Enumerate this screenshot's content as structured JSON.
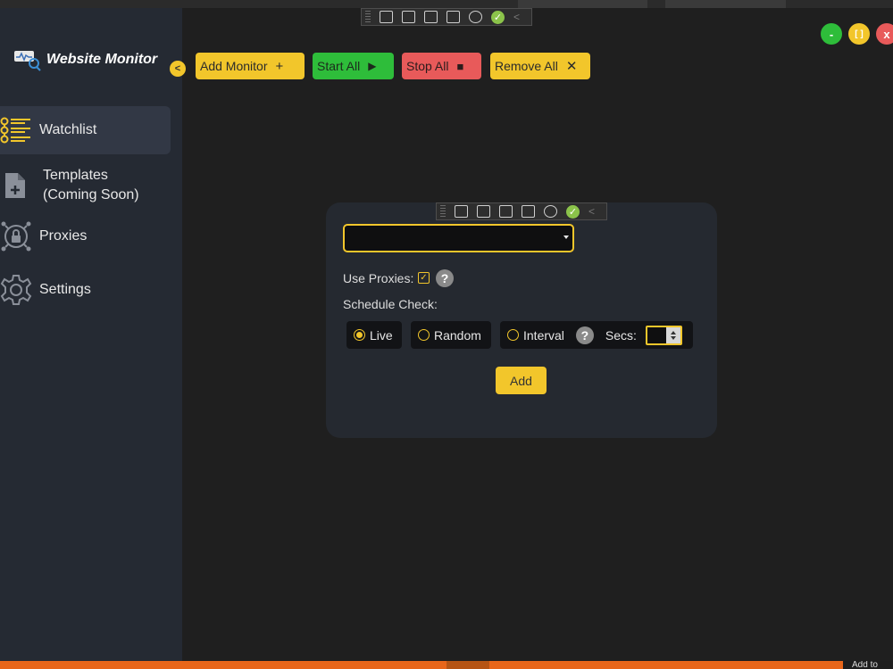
{
  "app": {
    "title": "Website Monitor"
  },
  "sidebar": {
    "collapse_glyph": "<",
    "items": [
      {
        "label": "Watchlist",
        "icon": "watchlist-icon",
        "active": true
      },
      {
        "label": "Templates",
        "label2": "(Coming Soon)",
        "icon": "add-file-icon"
      },
      {
        "label": "Proxies",
        "icon": "proxy-lock-icon"
      },
      {
        "label": "Settings",
        "icon": "gear-icon"
      }
    ]
  },
  "toolbar": {
    "add_monitor": "Add Monitor",
    "add_monitor_sym": "+",
    "start_all": "Start All",
    "start_all_sym": "▶",
    "stop_all": "Stop All",
    "stop_all_sym": "■",
    "remove_all": "Remove All",
    "remove_all_sym": "✕"
  },
  "window_controls": {
    "minimize": "-",
    "maximize": "[ ]",
    "close": "x"
  },
  "dev_toolbar": {
    "check": "✓",
    "collapse": "<"
  },
  "form": {
    "url_value": "",
    "use_proxies_label": "Use Proxies:",
    "use_proxies_checked": true,
    "help_glyph": "?",
    "schedule_label": "Schedule Check:",
    "schedule_options": [
      "Live",
      "Random",
      "Interval"
    ],
    "schedule_selected": "Live",
    "secs_label": "Secs:",
    "secs_value": "",
    "add_label": "Add"
  },
  "colors": {
    "accent": "#f2c62b",
    "start": "#2ebd3a",
    "stop": "#e85a5a",
    "sidebar": "#252a33",
    "panel": "#252930"
  },
  "taskbar": {
    "right_text": "Add to"
  }
}
